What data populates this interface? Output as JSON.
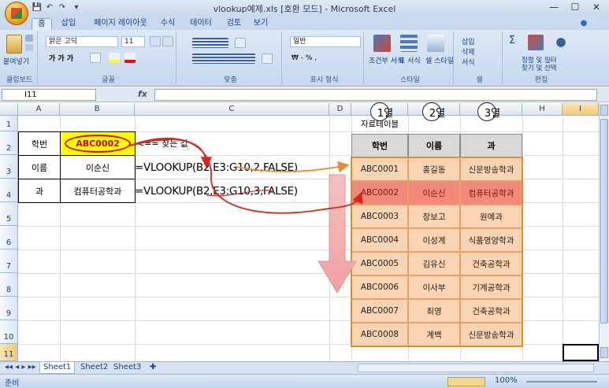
{
  "window": {
    "title": "vlookup예제.xls  [호환 모드] - Microsoft Excel",
    "minimize": "—",
    "maximize": "☐",
    "close": "✕"
  },
  "qat": [
    "💾",
    "↶",
    "↷",
    "▾"
  ],
  "tabs": [
    "홈",
    "삽입",
    "페이지 레이아웃",
    "수식",
    "데이터",
    "검토",
    "보기"
  ],
  "ribbon": {
    "clipboard": {
      "paste": "붙여넣기",
      "label": "클립보드"
    },
    "font": {
      "name": "맑은 고딕",
      "size": "11",
      "label": "글꼴"
    },
    "align": {
      "label": "맞춤"
    },
    "number": {
      "format": "일반",
      "currency": "₩ - % ,",
      "label": "표시 형식"
    },
    "styles": {
      "cond": "조건부 서식",
      "table": "표 서식",
      "cell": "셀 스타일",
      "label": "스타일"
    },
    "cells": {
      "insert": "삽입",
      "delete": "삭제",
      "format": "서식",
      "label": "셀"
    },
    "edit": {
      "sort": "정렬 및 필터",
      "find": "찾기 및 선택",
      "label": "편집"
    }
  },
  "namebox": "I11",
  "fx": "fx",
  "columns": [
    "A",
    "B",
    "C",
    "D",
    "E",
    "F",
    "G",
    "H",
    "I"
  ],
  "rows": [
    "1",
    "2",
    "3",
    "4",
    "5",
    "6",
    "7",
    "8",
    "9",
    "10",
    "11"
  ],
  "cells": {
    "a2": "학번",
    "b2": "ABC0002",
    "c2": "<== 찾는 값",
    "a3": "이름",
    "b3": "이순신",
    "c3": "=VLOOKUP(B2,E3:G10,2,FALSE)",
    "a4": "과",
    "b4": "컴퓨터공학과",
    "c4": "=VLOOKUP(B2,E3:G10,3,FALSE)",
    "e1": "자료테이블"
  },
  "col_numbers": [
    "1열",
    "2열",
    "3열"
  ],
  "table": {
    "headers": [
      "학번",
      "이름",
      "과"
    ],
    "rows": [
      [
        "ABC0001",
        "홍길동",
        "신문방송학과"
      ],
      [
        "ABC0002",
        "이순신",
        "컴퓨터공학과"
      ],
      [
        "ABC0003",
        "장보고",
        "원예과"
      ],
      [
        "ABC0004",
        "이성계",
        "식품영양학과"
      ],
      [
        "ABC0005",
        "김유신",
        "건축공학과"
      ],
      [
        "ABC0006",
        "이사부",
        "기계공학과"
      ],
      [
        "ABC0007",
        "최영",
        "건축공학과"
      ],
      [
        "ABC0008",
        "계백",
        "신문방송학과"
      ]
    ],
    "highlight_row": 1
  },
  "sheets": [
    "Sheet1",
    "Sheet2",
    "Sheet3"
  ],
  "status": {
    "mode": "준비",
    "zoom": "100%"
  },
  "colors": {
    "highlight_yellow": "#ffff00",
    "ellipse_red": "#e60000",
    "arrow_red": "#d9261c",
    "arrow_orange": "#f0891e",
    "table_fill": "#fbd4b4"
  }
}
